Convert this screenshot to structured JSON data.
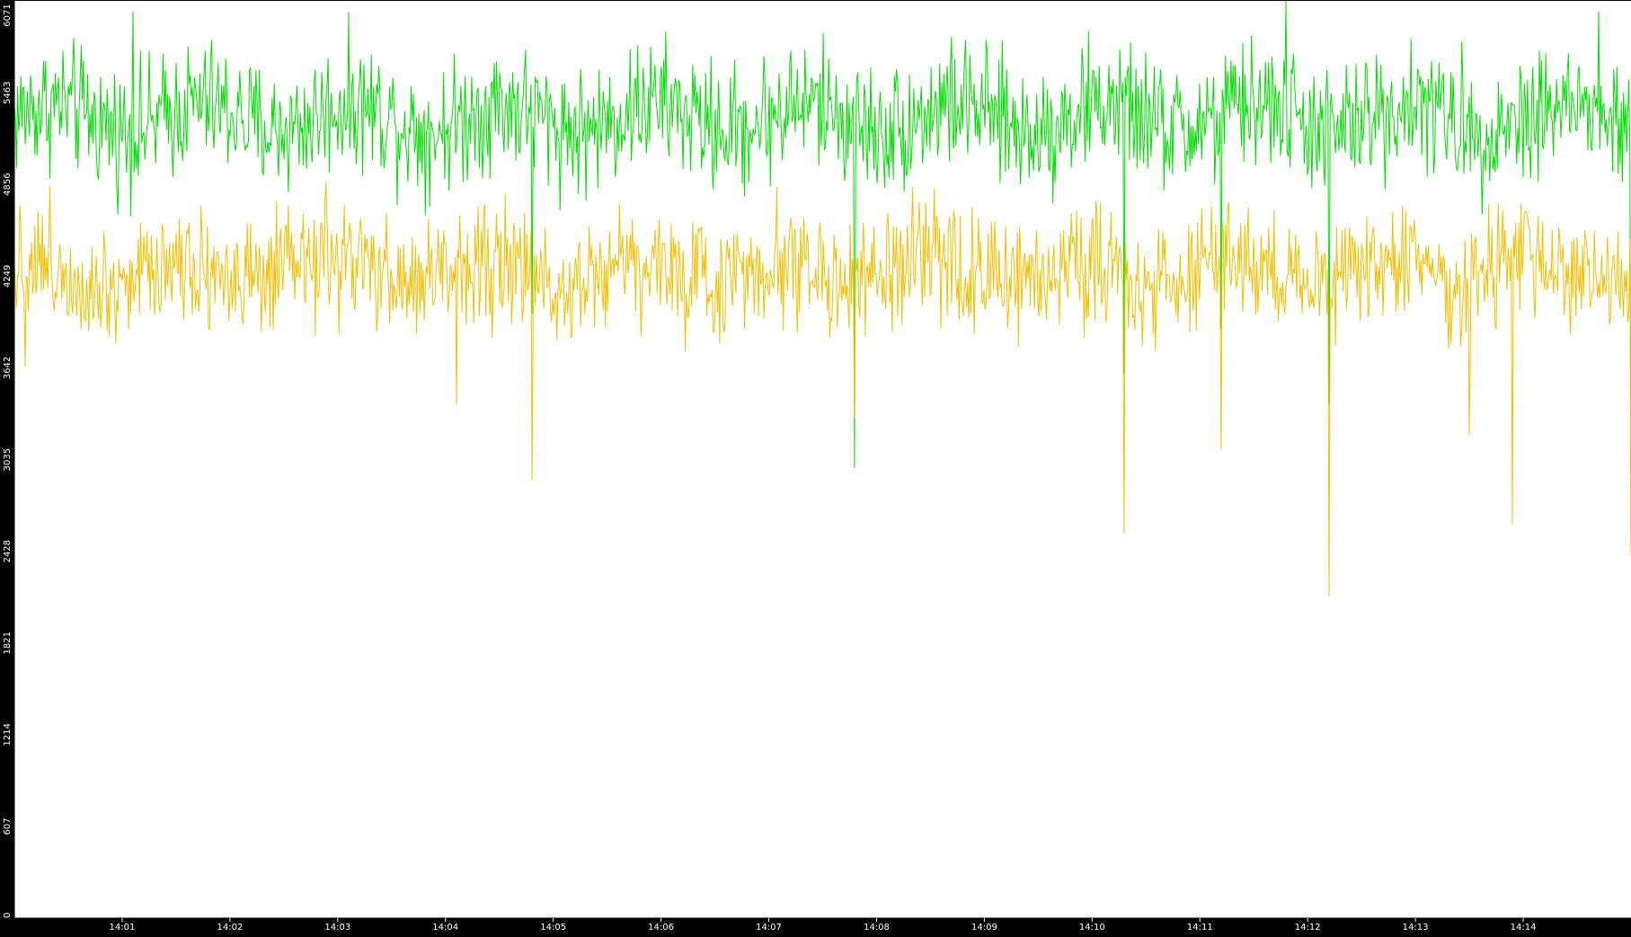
{
  "chart_data": {
    "type": "line",
    "x_ticks": [
      "14:01",
      "14:02",
      "14:03",
      "14:04",
      "14:05",
      "14:06",
      "14:07",
      "14:08",
      "14:09",
      "14:10",
      "14:11",
      "14:12",
      "14:13",
      "14:14"
    ],
    "y_ticks": [
      "0",
      "607",
      "1214",
      "1821",
      "2428",
      "3035",
      "3642",
      "4249",
      "4856",
      "5463",
      "6071"
    ],
    "ylim": [
      0,
      6071
    ],
    "xlim_minutes": [
      0.0,
      15.0
    ],
    "x_tick_minutes": [
      1,
      2,
      3,
      4,
      5,
      6,
      7,
      8,
      9,
      10,
      11,
      12,
      13,
      14
    ],
    "grid": false,
    "legend": "none",
    "background_color": "#ffffff",
    "axis_color": "#000000",
    "series": [
      {
        "color": "#00e000",
        "mean_y": 5300,
        "spread_y": 350,
        "samples": 1500,
        "dips": [
          {
            "minute": 4.8,
            "value": 4000
          },
          {
            "minute": 7.8,
            "value": 2980
          },
          {
            "minute": 10.3,
            "value": 3600
          },
          {
            "minute": 11.2,
            "value": 3900
          },
          {
            "minute": 12.2,
            "value": 3400
          },
          {
            "minute": 15.0,
            "value": 2600
          }
        ],
        "spikes": [
          {
            "minute": 1.1,
            "value": 6000
          },
          {
            "minute": 11.8,
            "value": 6071
          },
          {
            "minute": 14.7,
            "value": 6000
          }
        ]
      },
      {
        "color": "#f5bf00",
        "mean_y": 4280,
        "spread_y": 330,
        "samples": 1500,
        "dips": [
          {
            "minute": 0.1,
            "value": 3650
          },
          {
            "minute": 4.1,
            "value": 3400
          },
          {
            "minute": 4.8,
            "value": 2900
          },
          {
            "minute": 7.8,
            "value": 3300
          },
          {
            "minute": 10.3,
            "value": 2550
          },
          {
            "minute": 11.2,
            "value": 3100
          },
          {
            "minute": 12.2,
            "value": 2130
          },
          {
            "minute": 13.5,
            "value": 3200
          },
          {
            "minute": 13.9,
            "value": 2600
          },
          {
            "minute": 15.0,
            "value": 2400
          }
        ],
        "spikes": []
      }
    ]
  }
}
